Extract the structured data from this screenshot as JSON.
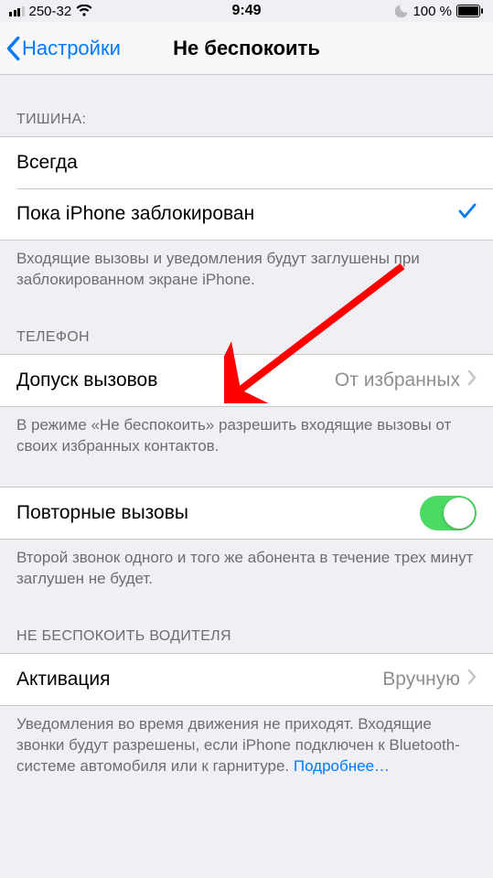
{
  "statusbar": {
    "carrier": "250-32",
    "time": "9:49",
    "battery": "100 %"
  },
  "nav": {
    "back": "Настройки",
    "title": "Не беспокоить"
  },
  "sections": {
    "silence": {
      "header": "Тишина:",
      "always": "Всегда",
      "whileLocked": "Пока iPhone заблокирован",
      "footer": "Входящие вызовы и уведомления будут заглушены при заблокированном экране iPhone."
    },
    "phone": {
      "header": "Телефон",
      "allowCalls": "Допуск вызовов",
      "allowCallsValue": "От избранных",
      "footer": "В режиме «Не беспокоить» разрешить входящие вызовы от своих избранных контактов."
    },
    "repeated": {
      "label": "Повторные вызовы",
      "footer": "Второй звонок одного и того же абонента в течение трех минут заглушен не будет."
    },
    "driving": {
      "header": "Не беспокоить водителя",
      "activation": "Активация",
      "activationValue": "Вручную",
      "footerPrefix": "Уведомления во время движения не приходят. Входящие звонки будут разрешены, если iPhone подключен к Bluetooth-системе автомобиля или к гарнитуре. ",
      "footerLink": "Подробнее…"
    }
  }
}
